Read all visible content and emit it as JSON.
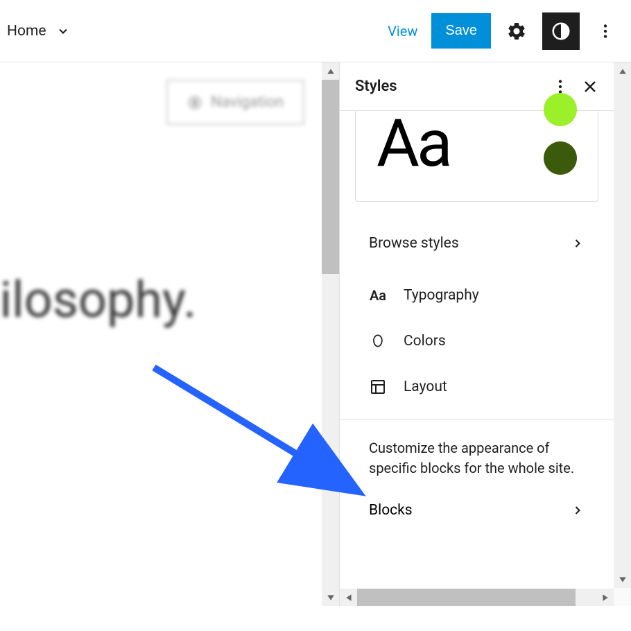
{
  "topbar": {
    "home_label": "Home",
    "view_label": "View",
    "save_label": "Save"
  },
  "canvas": {
    "nav_block_label": "Navigation",
    "heading_text": "hilosophy."
  },
  "sidebar": {
    "title": "Styles",
    "preview_text": "Aa",
    "colors": {
      "lime": "#9cf029",
      "olive": "#3b5a0b"
    },
    "browse_label": "Browse styles",
    "typography_label": "Typography",
    "colors_label": "Colors",
    "layout_label": "Layout",
    "blocks_description": "Customize the appearance of specific blocks for the whole site.",
    "blocks_label": "Blocks"
  }
}
